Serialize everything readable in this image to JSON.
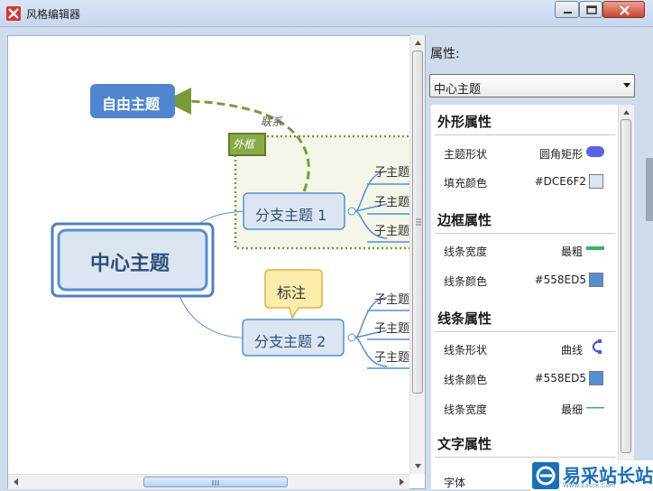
{
  "window": {
    "title": "风格编辑器"
  },
  "mindmap": {
    "central_topic": "中心主题",
    "floating_topic": "自由主题",
    "relationship_label": "联系",
    "boundary_label": "外框",
    "callout_label": "标注",
    "branch_1": "分支主题 1",
    "branch_2": "分支主题 2",
    "branch_1_subtopics": [
      "子主题",
      "子主题",
      "子主题"
    ],
    "branch_2_subtopics": [
      "子主题",
      "子主题",
      "子主题"
    ]
  },
  "properties": {
    "title": "属性:",
    "selected": "中心主题",
    "sections": {
      "shape": {
        "header": "外形属性",
        "shape_label": "主题形状",
        "shape_value": "圆角矩形",
        "fill_label": "填充颜色",
        "fill_value": "#DCE6F2"
      },
      "border": {
        "header": "边框属性",
        "width_label": "线条宽度",
        "width_value": "最粗",
        "color_label": "线条颜色",
        "color_value": "#558ED5"
      },
      "line": {
        "header": "线条属性",
        "shape_label": "线条形状",
        "shape_value": "曲线",
        "color_label": "线条颜色",
        "color_value": "#558ED5",
        "width_label": "线条宽度",
        "width_value": "最细"
      },
      "text": {
        "header": "文字属性",
        "font_label": "字体"
      }
    }
  },
  "colors": {
    "fill": "#DCE6F2",
    "line": "#558ED5",
    "shape_swatch": "#5a63e6",
    "border_swatch": "#2eb56c",
    "line_swatch": "#3da77a",
    "floating_fill": "#4f86cf",
    "boundary_fill": "#f3f6e8",
    "boundary_stroke": "#7a9a3a",
    "callout_fill": "#fdedab",
    "callout_stroke": "#e0b336"
  },
  "watermark": {
    "brand": "易采站长站",
    "url": "Www.Easck.Com"
  }
}
